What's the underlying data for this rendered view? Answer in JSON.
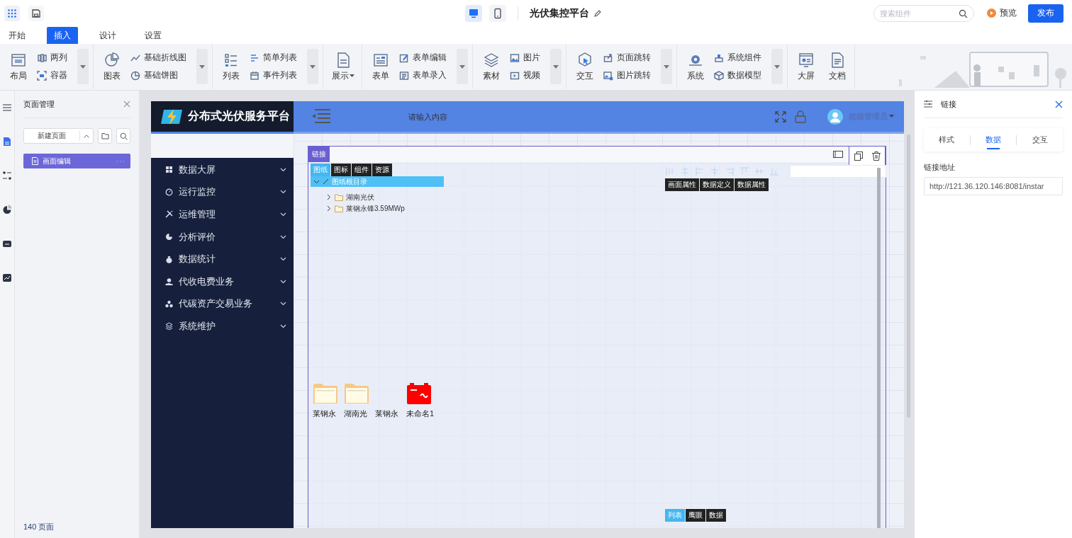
{
  "toolbar": {
    "device_toggles": [
      {
        "kind": "desktop",
        "selected": true
      },
      {
        "kind": "mobile",
        "selected": false
      }
    ],
    "title": "光伏集控平台",
    "search": {
      "placeholder": "搜索组件"
    },
    "preview": "预览",
    "publish": "发布"
  },
  "menu_tabs": [
    {
      "label": "开始",
      "selected": false
    },
    {
      "label": "插入",
      "selected": true
    },
    {
      "label": "设计",
      "selected": false
    },
    {
      "label": "设置",
      "selected": false
    }
  ],
  "ribbon": [
    {
      "large": [
        {
          "label": "布局",
          "has_menu": false
        }
      ],
      "small": [
        "两列",
        "容器"
      ],
      "more": true
    },
    {
      "large": [
        {
          "label": "图表",
          "has_menu": false
        }
      ],
      "small": [
        "基础折线图",
        "基础饼图"
      ],
      "more": true
    },
    {
      "large": [
        {
          "label": "列表",
          "has_menu": false
        }
      ],
      "small": [
        "简单列表",
        "事件列表"
      ],
      "more": true
    },
    {
      "large": [
        {
          "label": "展示",
          "has_menu": true
        }
      ],
      "more": false
    },
    {
      "large": [
        {
          "label": "表单",
          "has_menu": false
        }
      ],
      "small": [
        "表单编辑",
        "表单录入"
      ],
      "more": true
    },
    {
      "large": [
        {
          "label": "素材",
          "has_menu": false
        }
      ],
      "small": [
        "图片",
        "视频"
      ],
      "more": true
    },
    {
      "large": [
        {
          "label": "交互",
          "has_menu": false
        }
      ],
      "small": [
        "页面跳转",
        "图片跳转"
      ],
      "more": true
    },
    {
      "large": [
        {
          "label": "系统",
          "has_menu": false
        }
      ],
      "small": [
        "系统组件",
        "数据模型"
      ],
      "more": true
    },
    {
      "large": [
        {
          "label": "大屏",
          "has_menu": false
        },
        {
          "label": "文档",
          "has_menu": false
        }
      ],
      "more": false
    }
  ],
  "rail_items": [
    {
      "selected": false
    },
    {
      "selected": true
    },
    {
      "selected": false
    },
    {
      "selected": false
    },
    {
      "selected": false
    },
    {
      "selected": false
    }
  ],
  "page_panel": {
    "title": "页面管理",
    "new_page": "新建页面",
    "pages": [
      {
        "label": "画面编辑",
        "selected": true
      }
    ],
    "count": "140 页面"
  },
  "preview": {
    "brand": "分布式光伏服务平台",
    "search_placeholder": "请输入内容",
    "user": "超级管理员",
    "nav": [
      "数据大屏",
      "运行监控",
      "运维管理",
      "分析评价",
      "数据统计",
      "代收电费业务",
      "代碳资产交易业务",
      "系统维护"
    ],
    "component": {
      "tag": "链接",
      "left_tabs": [
        {
          "label": "图纸",
          "selected": true
        },
        {
          "label": "图标",
          "selected": false
        },
        {
          "label": "组件",
          "selected": false
        },
        {
          "label": "资源",
          "selected": false
        }
      ],
      "tree": [
        {
          "label": "图纸根目录",
          "expanded": true,
          "selected": true,
          "children": [
            {
              "label": "湖南光伏",
              "expanded": false,
              "selected": false
            },
            {
              "label": "莱钢永锋3.59MWp",
              "expanded": false,
              "selected": false
            }
          ]
        }
      ],
      "prop_tabs": [
        "画面属性",
        "数据定义",
        "数据属性"
      ],
      "files": [
        {
          "label": "莱钢永",
          "kind": "folder"
        },
        {
          "label": "湖南光",
          "kind": "folder"
        },
        {
          "label": "莱钢永",
          "kind": "blank"
        },
        {
          "label": "未命名1",
          "kind": "battery"
        }
      ],
      "bottom_tabs": [
        {
          "label": "列表",
          "selected": true
        },
        {
          "label": "鹰眼",
          "selected": false
        },
        {
          "label": "数据",
          "selected": false
        }
      ]
    }
  },
  "inspector": {
    "title": "链接",
    "tabs": [
      {
        "label": "样式",
        "selected": false
      },
      {
        "label": "数据",
        "selected": true
      },
      {
        "label": "交互",
        "selected": false
      }
    ],
    "field_label": "链接地址",
    "field_value": "http://121.36.120.146:8081/instar"
  }
}
